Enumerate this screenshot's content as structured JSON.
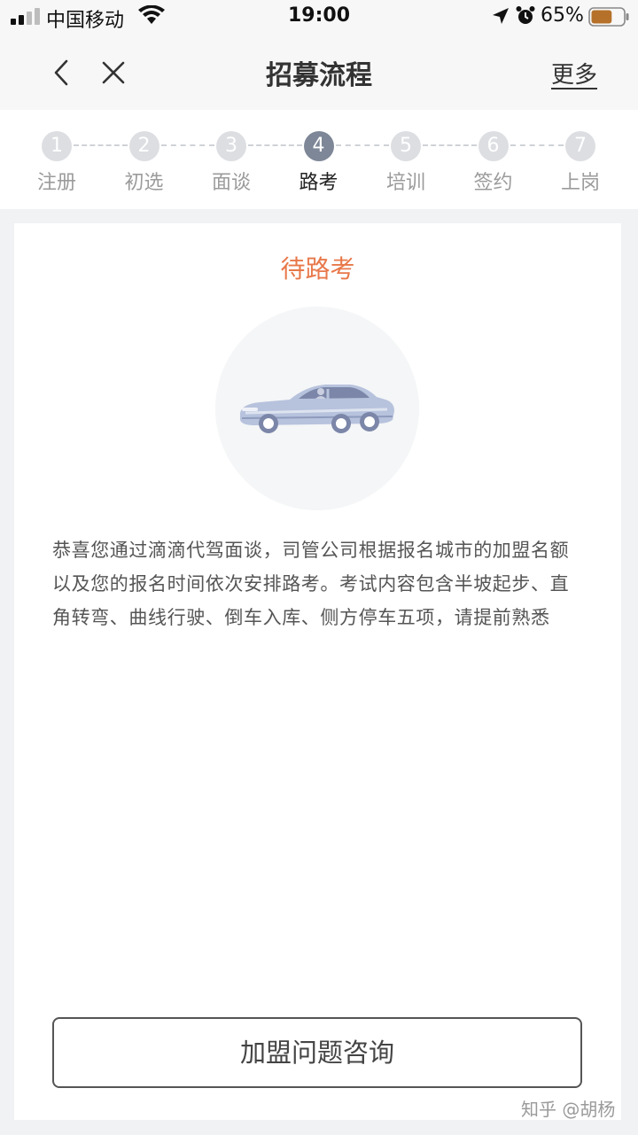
{
  "status_bar": {
    "carrier": "中国移动",
    "time": "19:00",
    "battery_percent": "65%",
    "battery_level": 0.65,
    "battery_color": "#b5712a",
    "icons": [
      "signal-icon",
      "wifi-icon",
      "location-arrow-icon",
      "alarm-icon",
      "battery-icon"
    ]
  },
  "nav": {
    "title": "招募流程",
    "more_label": "更多",
    "icons": [
      "back-chevron-icon",
      "close-icon"
    ]
  },
  "steps": [
    {
      "number": "1",
      "label": "注册",
      "active": false
    },
    {
      "number": "2",
      "label": "初选",
      "active": false
    },
    {
      "number": "3",
      "label": "面谈",
      "active": false
    },
    {
      "number": "4",
      "label": "路考",
      "active": true
    },
    {
      "number": "5",
      "label": "培训",
      "active": false
    },
    {
      "number": "6",
      "label": "签约",
      "active": false
    },
    {
      "number": "7",
      "label": "上岗",
      "active": false
    }
  ],
  "card": {
    "status_title": "待路考",
    "status_color": "#e8784a",
    "illustration_icon": "car-icon",
    "description": "恭喜您通过滴滴代驾面谈，司管公司根据报名城市的加盟名额以及您的报名时间依次安排路考。考试内容包含半坡起步、直角转弯、曲线行驶、倒车入库、侧方停车五项，请提前熟悉",
    "button_label": "加盟问题咨询"
  },
  "watermark": "知乎 @胡杨"
}
